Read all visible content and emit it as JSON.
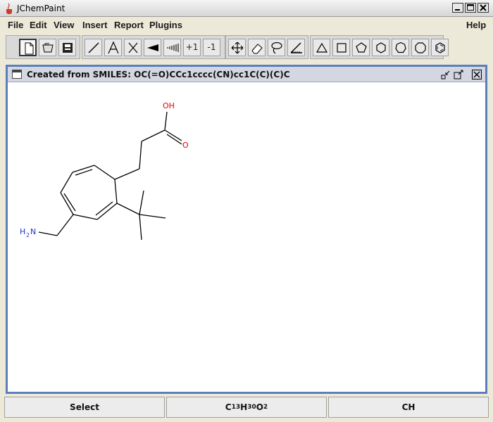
{
  "window": {
    "title": "JChemPaint",
    "buttons": [
      "minimize-icon",
      "maximize-icon",
      "close-icon"
    ]
  },
  "menubar": {
    "items": [
      "File",
      "Edit",
      "View",
      "Insert",
      "Report",
      "Plugins"
    ],
    "help": "Help"
  },
  "toolbar": {
    "group1": [
      "new-document-icon",
      "open-icon",
      "save-icon"
    ],
    "group2": [
      "single-bond-icon",
      "text-icon",
      "delete-atom-icon",
      "wedge-bond-icon",
      "hash-bond-icon",
      "charge-plus-button",
      "charge-minus-button"
    ],
    "charge_plus": "+1",
    "charge_minus": "-1",
    "group3": [
      "move-icon",
      "eraser-icon",
      "lasso-icon",
      "ruler-icon"
    ],
    "group4": [
      "triangle-icon",
      "square-icon",
      "pentagon-icon",
      "hexagon-icon",
      "heptagon-icon",
      "octagon-icon",
      "benzene-icon"
    ]
  },
  "document": {
    "title": "Created from SMILES: OC(=O)CCc1cccc(CN)cc1C(C)(C)C",
    "atom_labels": {
      "hydroxyl": "OH",
      "oxygen": "O",
      "amine_h": "H",
      "amine_sub": "2",
      "amine_n": "N"
    },
    "colors": {
      "oxygen": "#e00000",
      "nitrogen": "#2030d0",
      "bond": "#000000"
    }
  },
  "statusbar": {
    "mode": "Select",
    "formula": {
      "c": "C",
      "c_count": "13",
      "h": "H",
      "h_count": "30",
      "o": "O",
      "o_count": "2"
    },
    "selection": "CH"
  }
}
